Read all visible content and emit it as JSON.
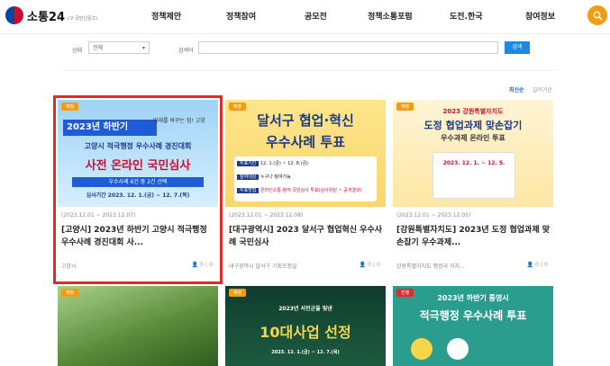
{
  "header": {
    "logo_text": "소통24",
    "logo_sub": "(구 국민신문고)",
    "nav": [
      "정책제안",
      "정책참여",
      "공모전",
      "정책소통포럼",
      "도전.한국",
      "참여정보"
    ]
  },
  "filter": {
    "status_label": "상태",
    "status_value": "전체",
    "search_label": "검색어",
    "search_button": "검색"
  },
  "sort": {
    "active": "최신순",
    "inactive": "길어가순"
  },
  "cards": [
    {
      "badge": "예정",
      "badge_color": "#f39c12",
      "date": "(2023.12.01 ~ 2023.12.07)",
      "title": "[고양시] 2023년 하반기 고양시 적극행정 우수사례 경진대회 사...",
      "org": "고양시",
      "likes": "0",
      "shares": "0",
      "thumb_lines": [
        "2023년 하반기",
        "미래를 바꾸는 힘! 고양",
        "고양시 적극행정 우수사례 경진대회",
        "사전 온라인 국민심사",
        "우수사례 6건 중 2건 선택",
        "심사기간 2023. 12. 1.(금) ~ 12. 7.(목)"
      ]
    },
    {
      "badge": "예정",
      "badge_color": "#f39c12",
      "date": "(2023.12.01 ~ 2023.12.08)",
      "title": "[대구광역시] 2023 달서구 협업혁신 우수사례 국민심사",
      "org": "대구광역시 달서구 기획조정실",
      "likes": "0",
      "shares": "0",
      "thumb_lines": [
        "달서구 협업·혁신",
        "우수사례 투표",
        "투표기간",
        "12. 1.(금) ~ 12. 8.(금)",
        "참여대상",
        "누구나 참여가능",
        "투표방법",
        "온라인소통·참여 국민심사 투표(심사위원 ~ 공개결과)"
      ]
    },
    {
      "badge": "예정",
      "badge_color": "#f39c12",
      "date": "(2023.12.01 ~ 2023.12.05)",
      "title": "[강원특별자치도] 2023년 도정 협업과제 맞손잡기 우수과제...",
      "org": "강원특별자치도 행정국 자치...",
      "likes": "0",
      "shares": "0",
      "thumb_lines": [
        "2023 강원특별자치도",
        "도정 협업과제 맞손잡기",
        "우수과제 온라인 투표",
        "2023. 12. 1. ~ 12. 5."
      ]
    },
    {
      "badge": "예정",
      "badge_color": "#f39c12",
      "thumb_lines": []
    },
    {
      "badge": "예정",
      "badge_color": "#f39c12",
      "thumb_lines": [
        "2023년 서민군을 빛낸",
        "10대사업 선정",
        "2023. 12. 1.(금) ~ 12. 7.(목)"
      ]
    },
    {
      "badge": "진행",
      "badge_color": "#e02b2b",
      "thumb_lines": [
        "2023년 하반기 통영시",
        "적극행정 우수사례 투표"
      ]
    }
  ],
  "colors": {
    "accent": "#f39c12",
    "primary": "#1e88e5",
    "selected": "#e02b2b"
  }
}
